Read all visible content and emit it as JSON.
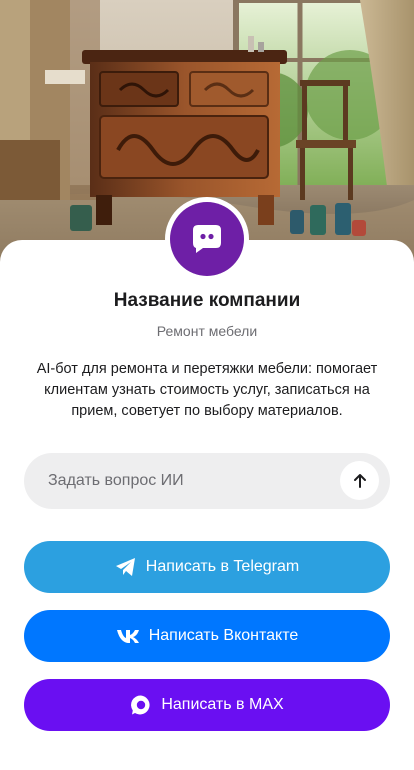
{
  "company": {
    "name": "Название компании",
    "subtitle": "Ремонт мебели",
    "description": "AI-бот для ремонта и перетяжки мебели: помогает клиентам узнать стоимость услуг, записаться на прием, советует по выбору материалов."
  },
  "hero": {
    "icon": "furniture-workshop-photo"
  },
  "avatar": {
    "icon": "chat-bot-icon",
    "color": "#6e1fa6"
  },
  "ask": {
    "placeholder": "Задать вопрос ИИ",
    "value": "",
    "send_icon": "arrow-up-icon"
  },
  "buttons": [
    {
      "label": "Написать в Telegram",
      "icon": "telegram-icon",
      "color": "#2ca0e0"
    },
    {
      "label": "Написать Вконтакте",
      "icon": "vk-icon",
      "color": "#0077ff"
    },
    {
      "label": "Написать в MAX",
      "icon": "max-icon",
      "color": "#6a0ff2"
    }
  ]
}
